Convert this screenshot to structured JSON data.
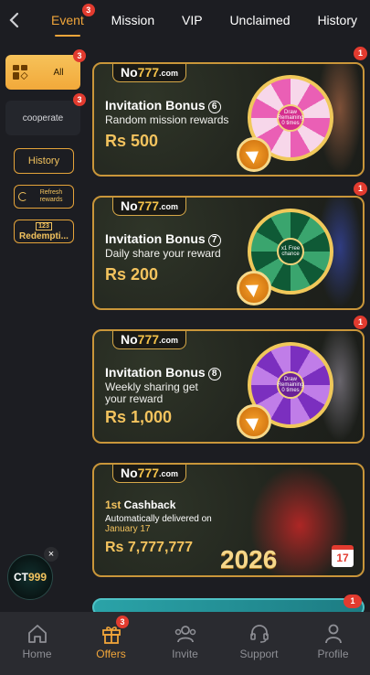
{
  "topbar": {
    "back_icon": "chevron-left-icon",
    "tabs": [
      {
        "label": "Event",
        "badge": "3",
        "active": true
      },
      {
        "label": "Mission"
      },
      {
        "label": "VIP"
      },
      {
        "label": "Unclaimed"
      },
      {
        "label": "History"
      }
    ]
  },
  "sidebar": {
    "categories": [
      {
        "label": "All",
        "badge": "3",
        "icon": "grid-icon",
        "active": true
      },
      {
        "label": "cooperate",
        "badge": "3"
      }
    ],
    "history_label": "History",
    "refresh_label": "Refresh rewards",
    "redemption_label": "Redempti..."
  },
  "cards": [
    {
      "badge": "1",
      "logo_a": "No",
      "logo_b": "777",
      "logo_c": ".com",
      "title": "Invitation Bonus",
      "number": "6",
      "subtitle": "Random mission rewards",
      "amount": "Rs 500",
      "hub": "Draw Remaining 0 times"
    },
    {
      "badge": "1",
      "logo_a": "No",
      "logo_b": "777",
      "logo_c": ".com",
      "title": "Invitation Bonus",
      "number": "7",
      "subtitle": "Daily share your reward",
      "amount": "Rs 200",
      "hub": "x1 Free chance"
    },
    {
      "badge": "1",
      "logo_a": "No",
      "logo_b": "777",
      "logo_c": ".com",
      "title": "Invitation Bonus",
      "number": "8",
      "subtitle": "Weekly sharing get your reward",
      "amount": "Rs 1,000",
      "hub": "Draw Remaining 0 times"
    },
    {
      "badge": "",
      "logo_a": "No",
      "logo_b": "777",
      "logo_c": ".com",
      "title_hl": "1st",
      "title": " Cashback",
      "subtitle": "Automatically delivered on",
      "subtitle_hl": "January 17",
      "amount": "Rs 7,777,777",
      "year": "2026",
      "calendar_day": "17"
    },
    {
      "badge": "1"
    }
  ],
  "floating_logo": {
    "text_a": "CT",
    "text_b": "999",
    "close": "×"
  },
  "bottom_nav": [
    {
      "label": "Home",
      "icon": "home-icon"
    },
    {
      "label": "Offers",
      "icon": "gift-icon",
      "badge": "3",
      "active": true
    },
    {
      "label": "Invite",
      "icon": "users-icon"
    },
    {
      "label": "Support",
      "icon": "headset-icon"
    },
    {
      "label": "Profile",
      "icon": "person-icon"
    }
  ],
  "colors": {
    "accent": "#f0a53a",
    "badge": "#e23b2f",
    "card_border": "#c9963a",
    "amount": "#f3c35e"
  }
}
